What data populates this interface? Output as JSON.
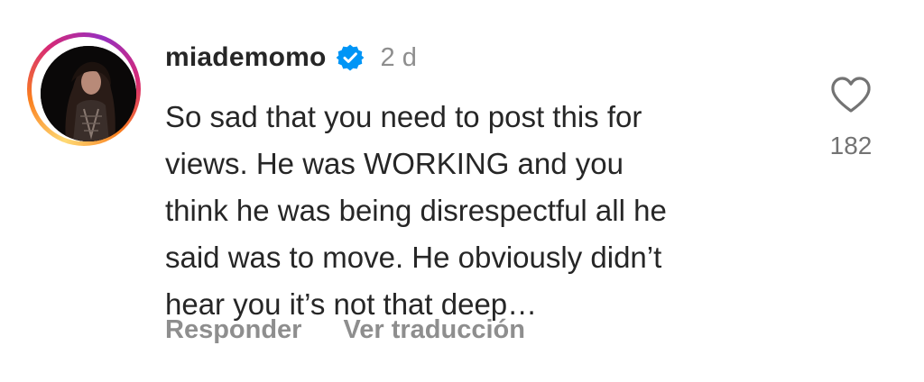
{
  "comment": {
    "username": "miademomo",
    "verified": true,
    "timestamp": "2 d",
    "text_lines": [
      "So sad that you need to post this for",
      "views. He was WORKING and you",
      "think he was being disrespectful all he",
      "said was to move. He obviously didn’t",
      "hear you it’s not that deep…"
    ],
    "like_count": "182",
    "reply_label": "Responder",
    "translate_label": "Ver traducción"
  },
  "icons": {
    "avatar": "avatar",
    "verified": "verified-badge-icon",
    "like": "heart-icon"
  },
  "colors": {
    "verified_blue": "#0095f6",
    "text": "#262626",
    "muted": "#8e8e8e"
  }
}
